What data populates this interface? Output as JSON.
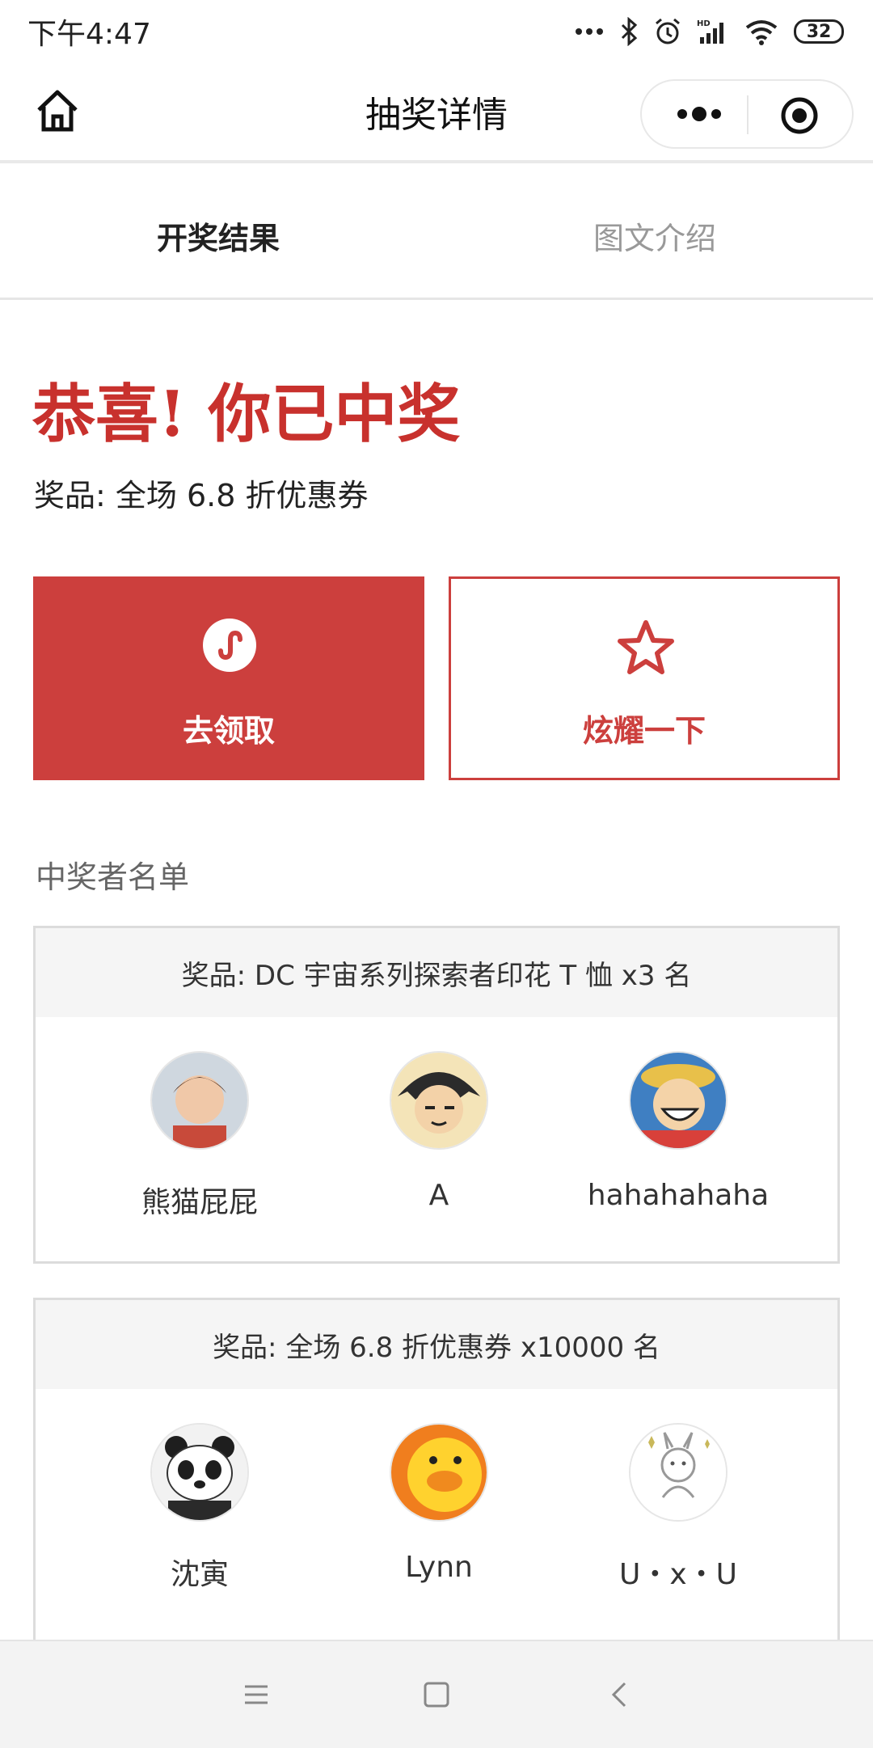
{
  "status_bar": {
    "time": "下午4:47",
    "battery": "32",
    "icons": [
      "dots-icon",
      "bluetooth-icon",
      "alarm-icon",
      "signal-icon",
      "wifi-icon",
      "battery-icon"
    ]
  },
  "nav": {
    "title": "抽奖详情",
    "icons": [
      "home-icon",
      "more-icon",
      "close-target-icon"
    ]
  },
  "tabs": [
    {
      "label": "开奖结果",
      "active": true
    },
    {
      "label": "图文介绍",
      "active": false
    }
  ],
  "result": {
    "headline": "恭喜! 你已中奖",
    "prize": "奖品: 全场 6.8 折优惠券"
  },
  "actions": {
    "claim_label": "去领取",
    "show_label": "炫耀一下",
    "accent_color": "#cc3f3d"
  },
  "winners": {
    "title": "中奖者名单",
    "groups": [
      {
        "prize": "奖品: DC 宇宙系列探索者印花 T 恤 x3 名",
        "people": [
          {
            "name": "熊猫屁屁"
          },
          {
            "name": "A"
          },
          {
            "name": "hahahahaha"
          }
        ]
      },
      {
        "prize": "奖品: 全场 6.8 折优惠券 x10000 名",
        "people": [
          {
            "name": "沈寅"
          },
          {
            "name": "Lynn"
          },
          {
            "name": "U・x・U"
          }
        ]
      }
    ]
  },
  "system_nav": {
    "icons": [
      "menu-icon",
      "home-square-icon",
      "back-icon"
    ]
  }
}
